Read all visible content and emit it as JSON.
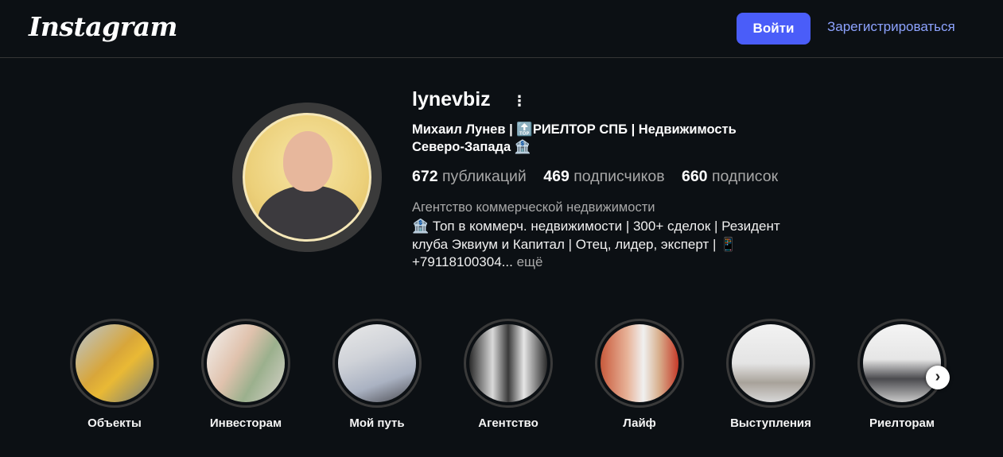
{
  "header": {
    "logo": "Instagram",
    "login_label": "Войти",
    "signup_label": "Зарегистрироваться"
  },
  "profile": {
    "username": "lynevbiz",
    "more_icon": "⋮",
    "full_name": "Михаил Лунев | 🔝РИЕЛТОР СПБ | Недвижимость Северо-Запада 🏦",
    "stats": [
      {
        "count": "672",
        "label": "публикаций"
      },
      {
        "count": "469",
        "label": "подписчиков"
      },
      {
        "count": "660",
        "label": "подписок"
      }
    ],
    "category": "Агентство коммерческой недвижимости",
    "bio": "🏦 Топ в коммерч. недвижимости | 300+ сделок | Резидент клуба Эквиум и Капитал | Отец, лидер, эксперт | 📱 +79118100304...",
    "bio_more": "ещё"
  },
  "highlights": [
    {
      "label": "Объекты"
    },
    {
      "label": "Инвесторам"
    },
    {
      "label": "Мой путь"
    },
    {
      "label": "Агентство"
    },
    {
      "label": "Лайф"
    },
    {
      "label": "Выступления"
    },
    {
      "label": "Риелторам"
    }
  ],
  "icons": {
    "next_arrow": "›"
  },
  "colors": {
    "background": "#0c1014",
    "login_button": "#4a5df9",
    "signup_link": "#8da3ff",
    "muted_text": "#a8a8a8"
  }
}
